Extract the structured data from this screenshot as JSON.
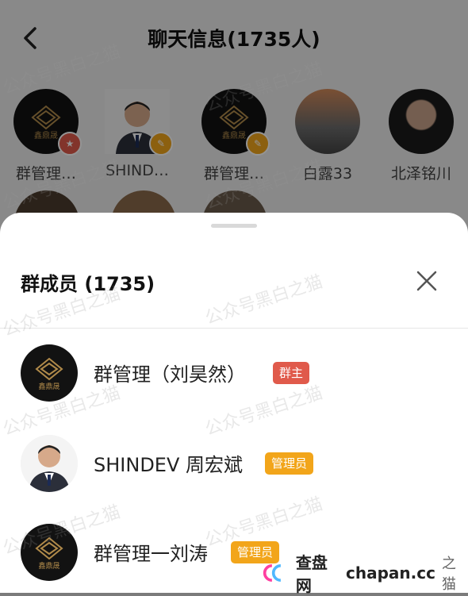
{
  "chat": {
    "title": "聊天信息(1735人)"
  },
  "background_members": [
    {
      "name": "群管理…",
      "badge": "★",
      "badge_color": "#e05a4b",
      "avatar": "logo"
    },
    {
      "name": "SHIND…",
      "badge": "✎",
      "badge_color": "#f2a51a",
      "avatar": "person"
    },
    {
      "name": "群管理…",
      "badge": "✎",
      "badge_color": "#f2a51a",
      "avatar": "logo"
    },
    {
      "name": "白露33",
      "badge": "",
      "badge_color": "",
      "avatar": "street"
    },
    {
      "name": "北泽铭川",
      "badge": "",
      "badge_color": "",
      "avatar": "dark"
    }
  ],
  "sheet": {
    "title": "群成员 (1735)",
    "members": [
      {
        "name": "群管理（刘昊然）",
        "tag": "群主",
        "tag_type": "owner",
        "avatar": "logo"
      },
      {
        "name": "SHINDEV 周宏斌",
        "tag": "管理员",
        "tag_type": "admin",
        "avatar": "person"
      },
      {
        "name": "群管理一刘涛",
        "tag": "管理员",
        "tag_type": "admin",
        "avatar": "logo"
      }
    ]
  },
  "watermark": {
    "text": "公众号黑白之猫",
    "site": "查盘网",
    "site_url_text": "chapan.cc",
    "site_suffix": "之猫"
  },
  "colors": {
    "owner_tag": "#e05a4b",
    "admin_tag": "#f2a51a"
  }
}
